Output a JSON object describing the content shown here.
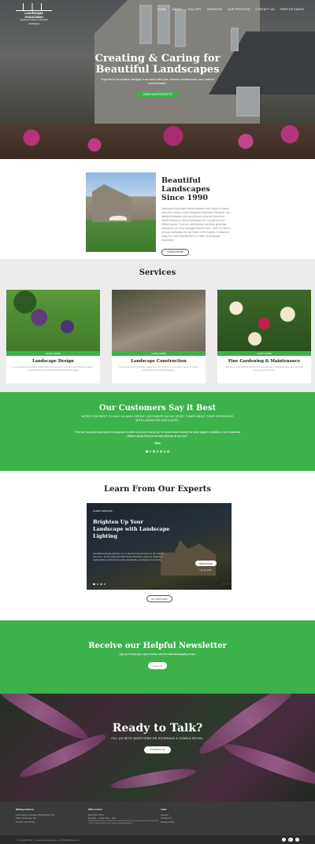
{
  "logo": {
    "line1": "Landscape Associates",
    "line2": "Creating & Caring for Beautiful Landscapes"
  },
  "nav": [
    "Home",
    "About",
    "Gallery",
    "Services",
    "Our Process",
    "Contact Us",
    "Free Estimate"
  ],
  "hero": {
    "title": "Creating & Caring for Beautiful Landscapes",
    "subtitle": "Experts in innovative designs that work with your home’s architecture and natural environment.",
    "cta": "View Our Projects"
  },
  "about": {
    "title": "Beautiful Landscapes Since 1990",
    "body": "Landscape Associates brings elegance and function to yards and other outdoor areas throughout Northeast Wisconsin. Our talented designers and experienced crews are experts at transforming your natural landscape into a gorgeous and efficient space. From our maintenance and lawn-grooming services to our snow management and more, relax: it’s time to put your landscape into the hands of the experts. Contact us today for a free estimate from our team of Landscape Associates.",
    "cta": "Learn More"
  },
  "services": {
    "title": "Services",
    "items": [
      {
        "bar": "Learn More",
        "name": "Landscape Design",
        "desc": "Our Landscape Associates design team lives and works to create and exceed our clients’ expectations for a beautiful and functional outdoor space."
      },
      {
        "bar": "Learn More",
        "name": "Landscape Construction",
        "desc": "Our experienced construction department can experience and install a variety of unique landscape and hardscape projects."
      },
      {
        "bar": "Learn More",
        "name": "Fine Gardening & Maintenance",
        "desc": "Maintaining your outdoor spaces is an essential part of total landscape care and helps protect your investment."
      }
    ]
  },
  "testimonials": {
    "title": "Our Customers Say it Best",
    "subtitle": "We’re confident to have so many repeat customers saying great things about their experience with Landscape Associates.",
    "quote": "“The size my project was small in comparison to other work you’re doing, but I’m certain mine received the same degree of attention. John created an efficient design that was finished perfectly as my crew.”",
    "author": "Sara"
  },
  "experts": {
    "title": "Learn From Our Experts",
    "tag": "Latest Articles",
    "article_title": "Brighten Up Your Landscape with Landscape Lighting",
    "article_body": "Incredible landscape lighting is one of the best improvements you can make to your home. Its low-voltage and LED fixtures illuminate a variety of hardscape, outdoor lighting enhances the safety, functionality, and beauty of your home.",
    "read_more": "Read More",
    "date": "July 30, 2018",
    "all": "All Articles"
  },
  "newsletter": {
    "title": "Receive our Helpful Newsletter",
    "subtitle": "Sign up to keep tips, expert advice and the latest landscaping trends.",
    "cta": "Sign Up"
  },
  "ready": {
    "title": "Ready to Talk?",
    "subtitle": "Fill us with questions or schedule a consultation.",
    "cta": "Contact Us"
  },
  "footer": {
    "col1_title": "Mailing Address",
    "col1_lines": [
      "Landscape Associates W1234 Hwy Xxx",
      "Little Landscape, WI",
      "PO Box 123 WI 5xx"
    ],
    "col2_title": "Office Hours",
    "col2_lines": [
      "920-XXX-XXXX",
      "Monday – Friday 8am – 4pm",
      "Provide Hourly Service and Northeast and We Are Here In Our Landscape Area, Green Bay",
      "Of The Landscape Associates Website and Neighborhood"
    ],
    "col3_title": "Links",
    "col3_lines": [
      "Careers",
      "Contact Us",
      "Privacy Policy"
    ],
    "copyright": "© Copyright 2017 – Landscape Associates – All Rights Reserved",
    "social": [
      "f",
      "in",
      "t"
    ]
  }
}
